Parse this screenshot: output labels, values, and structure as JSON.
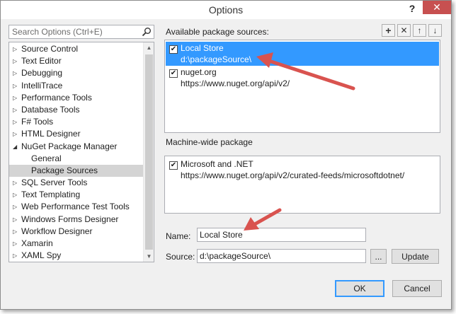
{
  "window": {
    "title": "Options",
    "help": "?",
    "close": "✕"
  },
  "search": {
    "placeholder": "Search Options (Ctrl+E)",
    "value": ""
  },
  "tree": {
    "items": [
      {
        "label": "Source Control",
        "arrow": "▷",
        "child": false,
        "selected": false
      },
      {
        "label": "Text Editor",
        "arrow": "▷",
        "child": false,
        "selected": false
      },
      {
        "label": "Debugging",
        "arrow": "▷",
        "child": false,
        "selected": false
      },
      {
        "label": "IntelliTrace",
        "arrow": "▷",
        "child": false,
        "selected": false
      },
      {
        "label": "Performance Tools",
        "arrow": "▷",
        "child": false,
        "selected": false
      },
      {
        "label": "Database Tools",
        "arrow": "▷",
        "child": false,
        "selected": false
      },
      {
        "label": "F# Tools",
        "arrow": "▷",
        "child": false,
        "selected": false
      },
      {
        "label": "HTML Designer",
        "arrow": "▷",
        "child": false,
        "selected": false
      },
      {
        "label": "NuGet Package Manager",
        "arrow": "◢",
        "child": false,
        "selected": false
      },
      {
        "label": "General",
        "arrow": "",
        "child": true,
        "selected": false
      },
      {
        "label": "Package Sources",
        "arrow": "",
        "child": true,
        "selected": true
      },
      {
        "label": "SQL Server Tools",
        "arrow": "▷",
        "child": false,
        "selected": false
      },
      {
        "label": "Text Templating",
        "arrow": "▷",
        "child": false,
        "selected": false
      },
      {
        "label": "Web Performance Test Tools",
        "arrow": "▷",
        "child": false,
        "selected": false
      },
      {
        "label": "Windows Forms Designer",
        "arrow": "▷",
        "child": false,
        "selected": false
      },
      {
        "label": "Workflow Designer",
        "arrow": "▷",
        "child": false,
        "selected": false
      },
      {
        "label": "Xamarin",
        "arrow": "▷",
        "child": false,
        "selected": false
      },
      {
        "label": "XAML Spy",
        "arrow": "▷",
        "child": false,
        "selected": false
      }
    ]
  },
  "available": {
    "label": "Available package sources:",
    "sources": [
      {
        "name": "Local Store",
        "url": "d:\\packageSource\\",
        "checked": "✔"
      },
      {
        "name": "nuget.org",
        "url": "https://www.nuget.org/api/v2/",
        "checked": "✔"
      }
    ]
  },
  "machine_wide": {
    "label": "Machine-wide package",
    "sources": [
      {
        "name": "Microsoft and .NET",
        "url": "https://www.nuget.org/api/v2/curated-feeds/microsoftdotnet/",
        "checked": "✔"
      }
    ]
  },
  "toolbar": {
    "add": "+",
    "remove": "✕",
    "up": "↑",
    "down": "↓"
  },
  "form": {
    "name_label": "Name:",
    "name_value": "Local Store",
    "source_label": "Source:",
    "source_value": "d:\\packageSource\\",
    "browse_label": "...",
    "update_label": "Update"
  },
  "buttons": {
    "ok": "OK",
    "cancel": "Cancel"
  },
  "colors": {
    "selection": "#3399ff",
    "arrow": "#d9534f",
    "close": "#c75050"
  }
}
